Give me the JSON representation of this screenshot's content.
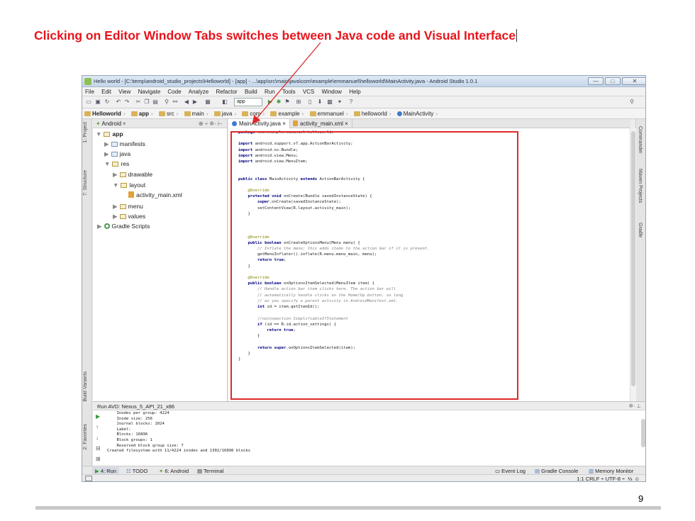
{
  "slide": {
    "title": "Clicking on Editor Window Tabs switches between Java code and Visual Interface",
    "page_number": "9"
  },
  "window": {
    "title": "Hello world - [C:\\temp\\android_studio_projects\\Helloworld] - [app] - ...\\app\\src\\main\\java\\com\\example\\emmanuel\\helloworld\\MainActivity.java - Android Studio 1.0.1",
    "minimize": "—",
    "maximize": "□",
    "close": "✕"
  },
  "menu": [
    "File",
    "Edit",
    "View",
    "Navigate",
    "Code",
    "Analyze",
    "Refactor",
    "Build",
    "Run",
    "Tools",
    "VCS",
    "Window",
    "Help"
  ],
  "toolbar": {
    "run_config": "app"
  },
  "breadcrumbs": [
    "Helloworld",
    "app",
    "src",
    "main",
    "java",
    "com",
    "example",
    "emmanuel",
    "helloworld",
    "MainActivity"
  ],
  "left_strip": [
    "1: Project",
    "7: Structure",
    "Build Variants",
    "2: Favorites"
  ],
  "right_strip": [
    "Commander",
    "Maven Projects",
    "Gradle"
  ],
  "project_panel": {
    "view": "Android",
    "tree": [
      {
        "label": "app",
        "arrow": "▼"
      },
      {
        "label": "manifests",
        "arrow": "▶"
      },
      {
        "label": "java",
        "arrow": "▶"
      },
      {
        "label": "res",
        "arrow": "▼"
      },
      {
        "label": "drawable",
        "arrow": "▶"
      },
      {
        "label": "layout",
        "arrow": "▼"
      },
      {
        "label": "activity_main.xml",
        "arrow": ""
      },
      {
        "label": "menu",
        "arrow": "▶"
      },
      {
        "label": "values",
        "arrow": "▶"
      },
      {
        "label": "Gradle Scripts",
        "arrow": "▶"
      }
    ]
  },
  "editor": {
    "tabs": [
      {
        "label": "MainActivity.java ×",
        "active": true
      },
      {
        "label": "activity_main.xml ×",
        "active": false
      }
    ],
    "code_lines": [
      "package com.example.emmanuel.helloworld;",
      "",
      "import android.support.v7.app.ActionBarActivity;",
      "import android.os.Bundle;",
      "import android.view.Menu;",
      "import android.view.MenuItem;",
      "",
      "",
      "public class MainActivity extends ActionBarActivity {",
      "",
      "    @Override",
      "    protected void onCreate(Bundle savedInstanceState) {",
      "        super.onCreate(savedInstanceState);",
      "        setContentView(R.layout.activity_main);",
      "    }",
      "",
      "",
      "",
      "    @Override",
      "    public boolean onCreateOptionsMenu(Menu menu) {",
      "        // Inflate the menu; this adds items to the action bar if it is present.",
      "        getMenuInflater().inflate(R.menu.menu_main, menu);",
      "        return true;",
      "    }",
      "",
      "    @Override",
      "    public boolean onOptionsItemSelected(MenuItem item) {",
      "        // Handle action bar item clicks here. The action bar will",
      "        // automatically handle clicks on the Home/Up button, so long",
      "        // as you specify a parent activity in AndroidManifest.xml.",
      "        int id = item.getItemId();",
      "",
      "        //noinspection SimplifiableIfStatement",
      "        if (id == R.id.action_settings) {",
      "            return true;",
      "        }",
      "",
      "        return super.onOptionsItemSelected(item);",
      "    }",
      "}"
    ]
  },
  "run_panel": {
    "header": "Run  AVD: Nexus_5_API_21_x86",
    "log_lines": [
      "    Inodes per group: 4224",
      "    Inode size: 256",
      "    Journal blocks: 1024",
      "    Label:",
      "    Blocks: 16896",
      "    Block groups: 1",
      "    Reserved block group size: 7",
      "Created filesystem with 11/4224 inodes and 1302/16896 blocks"
    ]
  },
  "bottom_tabs": {
    "run": "4: Run",
    "todo": "TODO",
    "android": "6: Android",
    "terminal": "Terminal",
    "event_log": "Event Log",
    "gradle_console": "Gradle Console",
    "memory_monitor": "Memory Monitor"
  },
  "status": {
    "right": "1:1  CRLF ÷  UTF-8 ÷"
  }
}
